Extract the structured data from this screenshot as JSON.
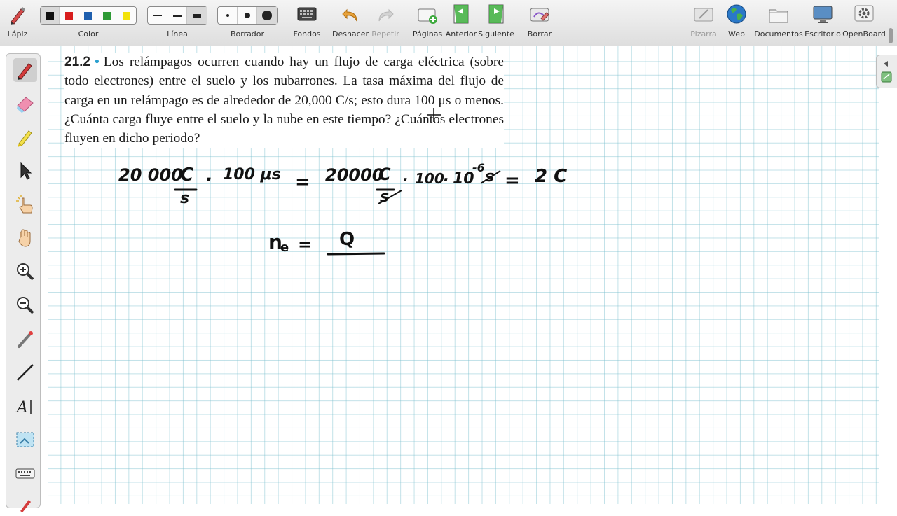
{
  "toolbar": {
    "pen_label": "Lápiz",
    "color_label": "Color",
    "line_label": "Línea",
    "eraser_label": "Borrador",
    "backgrounds_label": "Fondos",
    "undo_label": "Deshacer",
    "redo_label": "Repetir",
    "pages_label": "Páginas",
    "previous_label": "Anterior",
    "next_label": "Siguiente",
    "erase_label": "Borrar",
    "board_label": "Pizarra",
    "web_label": "Web",
    "documents_label": "Documentos",
    "desktop_label": "Escritorio",
    "openboard_label": "OpenBoard",
    "colors": [
      "#111111",
      "#d81e1e",
      "#1f5fae",
      "#2e9a35",
      "#f2e20b"
    ]
  },
  "problem": {
    "number": "21.2",
    "text": "Los relámpagos ocurren cuando hay un flujo de carga eléctrica (sobre todo electrones) entre el suelo y los nubarrones. La tasa máxima del flujo de carga en un relámpago es de alrededor de 20,000 C/s; esto dura 100 μs o menos. ¿Cuánta carga fluye entre el suelo y la nube en este tiempo? ¿Cuántos electrones fluyen en dicho periodo?"
  },
  "handwriting": {
    "rate": "20 000",
    "unit_c": "C",
    "unit_s": "s",
    "dot": "·",
    "time": "100 μs",
    "equals": "=",
    "rate2": "20000",
    "hundred": "100",
    "ten": "10",
    "exp": "-6",
    "s_cancelled": "s",
    "result": "2 C",
    "n_e": "n",
    "n_sub": "e",
    "q": "Q"
  }
}
